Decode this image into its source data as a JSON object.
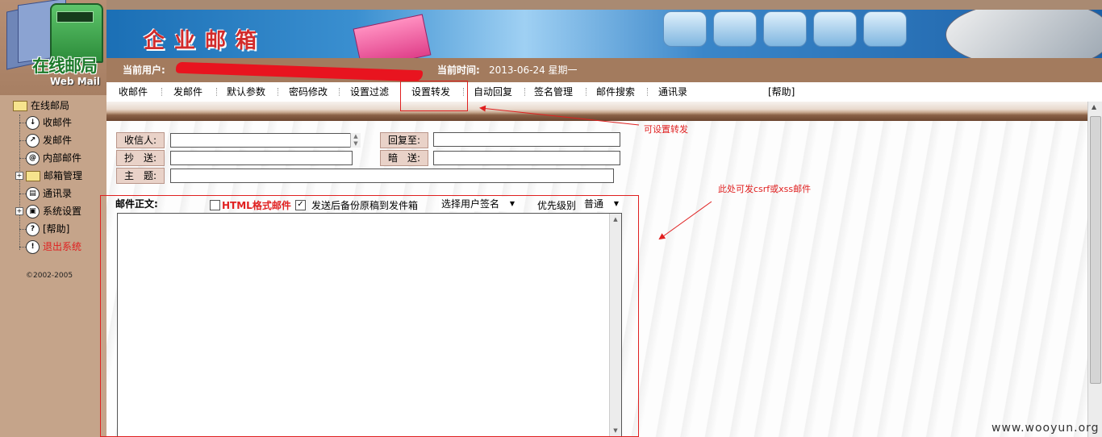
{
  "logo": {
    "title": "在线邮局",
    "subtitle": "Web Mail"
  },
  "banner": {
    "title": "企业邮箱"
  },
  "userbar": {
    "user_label": "当前用户:",
    "time_label": "当前时间:",
    "time_value": "2013-06-24 星期一"
  },
  "menu": {
    "items": [
      {
        "label": "收邮件"
      },
      {
        "label": "发邮件"
      },
      {
        "label": "默认参数"
      },
      {
        "label": "密码修改"
      },
      {
        "label": "设置过滤"
      },
      {
        "label": "设置转发"
      },
      {
        "label": "自动回复"
      },
      {
        "label": "签名管理"
      },
      {
        "label": "邮件搜索"
      },
      {
        "label": "通讯录"
      },
      {
        "label": "[帮助]"
      }
    ]
  },
  "sidebar": {
    "root": "在线邮局",
    "items": [
      {
        "label": "收邮件",
        "icon": "inbox-icon"
      },
      {
        "label": "发邮件",
        "icon": "send-icon"
      },
      {
        "label": "内部邮件",
        "icon": "internal-mail-icon"
      },
      {
        "label": "邮箱管理",
        "icon": "folder-icon"
      },
      {
        "label": "通讯录",
        "icon": "address-book-icon"
      },
      {
        "label": "系统设置",
        "icon": "settings-icon"
      },
      {
        "label": "[帮助]",
        "icon": "help-icon"
      },
      {
        "label": "退出系统",
        "icon": "logout-icon",
        "color": "#e02020"
      }
    ],
    "copyright": "©2002-2005"
  },
  "compose": {
    "to_label": "收信人:",
    "reply_to_label": "回复至:",
    "cc_label": "抄　送:",
    "bcc_label": "暗　送:",
    "subject_label": "主　题:",
    "body_label": "邮件正文:",
    "html_format_label": "HTML格式邮件",
    "html_format_checked": false,
    "save_copy_label": "发送后备份原稿到发件箱",
    "save_copy_checked": true,
    "signature_select": "选择用户签名",
    "priority_label": "优先级别",
    "priority_value": "普通"
  },
  "annotations": {
    "forward_note": "可设置转发",
    "csrf_note": "此处可发csrf或xss邮件",
    "color": "#e02020"
  },
  "watermark": "www.wooyun.org"
}
